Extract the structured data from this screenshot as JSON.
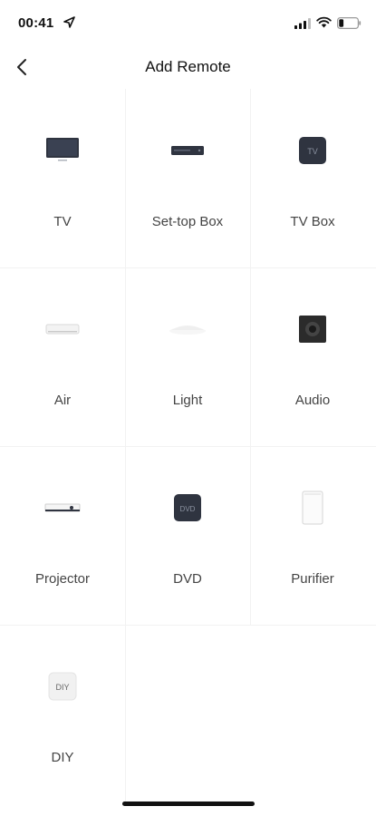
{
  "status_bar": {
    "time": "00:41"
  },
  "nav": {
    "title": "Add Remote"
  },
  "devices": [
    {
      "label": "TV",
      "icon": "tv-icon"
    },
    {
      "label": "Set-top Box",
      "icon": "set-top-box-icon"
    },
    {
      "label": "TV Box",
      "icon": "tv-box-icon"
    },
    {
      "label": "Air",
      "icon": "air-conditioner-icon"
    },
    {
      "label": "Light",
      "icon": "light-icon"
    },
    {
      "label": "Audio",
      "icon": "audio-speaker-icon"
    },
    {
      "label": "Projector",
      "icon": "projector-icon"
    },
    {
      "label": "DVD",
      "icon": "dvd-icon"
    },
    {
      "label": "Purifier",
      "icon": "purifier-icon"
    },
    {
      "label": "DIY",
      "icon": "diy-icon"
    }
  ],
  "icon_text": {
    "tv_box": "TV",
    "dvd": "DVD",
    "diy": "DIY"
  },
  "colors": {
    "device_dark": "#2f3440",
    "text_label": "#444444",
    "divider": "#f2f2f2"
  }
}
